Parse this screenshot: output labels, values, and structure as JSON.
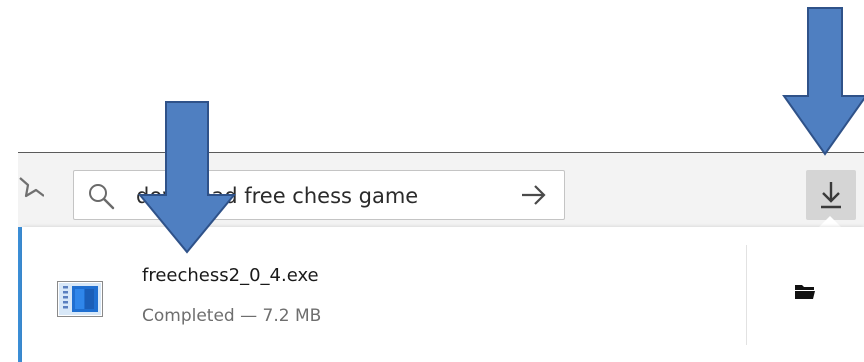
{
  "search": {
    "query": "download free chess game"
  },
  "icons": {
    "bookmark": "bookmark-star-icon",
    "search": "magnifier-icon",
    "go": "right-arrow-icon",
    "downloads": "download-arrow-icon",
    "file": "exe-file-icon",
    "folder": "folder-icon",
    "annotation": "blue-down-arrow"
  },
  "downloads_panel": {
    "items": [
      {
        "filename": "freechess2_0_4.exe",
        "status": "Completed — 7.2 MB"
      }
    ]
  },
  "colors": {
    "annotation_arrow": "#4f7fc1",
    "annotation_arrow_outline": "#2f5289",
    "accent_strip": "#3c8fd8",
    "toolbar_bg": "#f3f3f3",
    "download_button_bg": "#d5d5d5"
  }
}
